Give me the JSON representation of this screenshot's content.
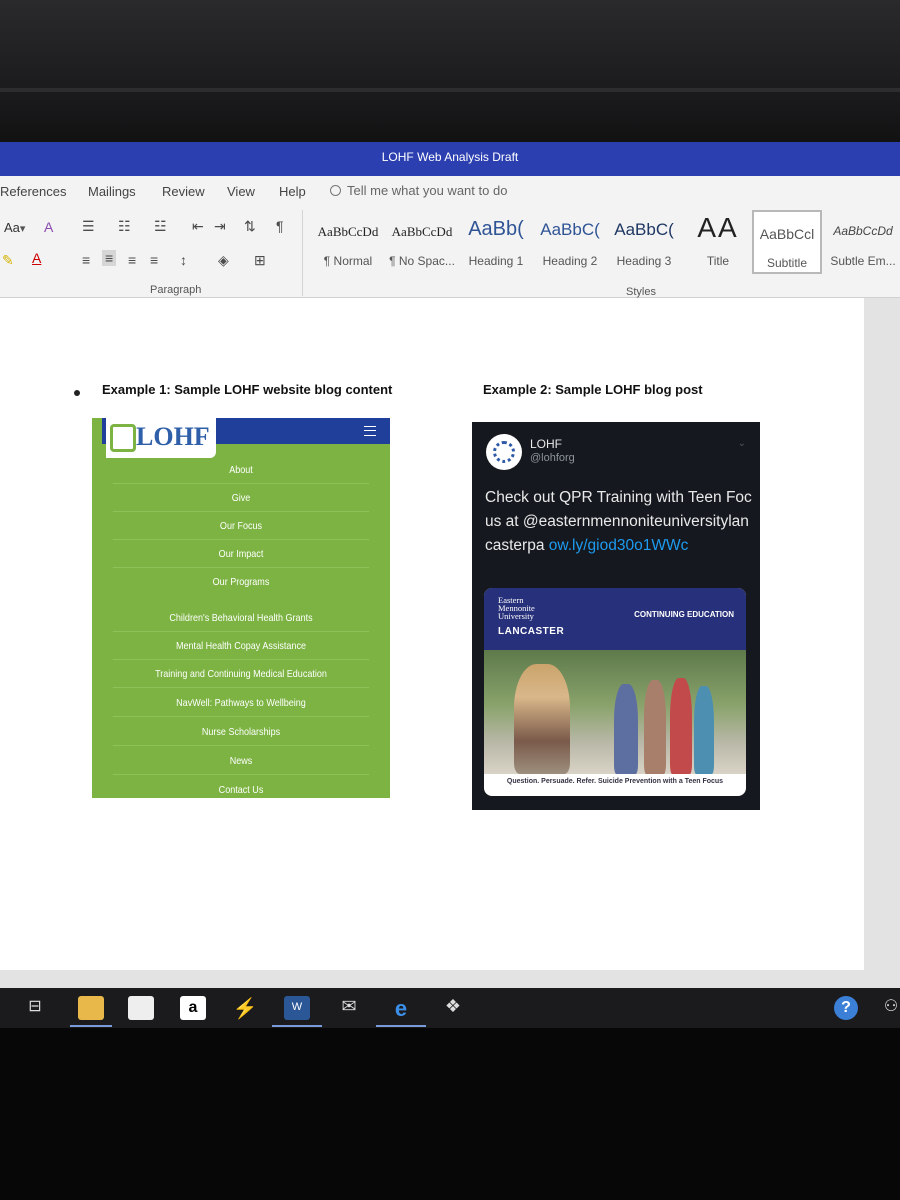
{
  "window": {
    "title": "LOHF Web Analysis Draft"
  },
  "tabs": [
    "References",
    "Mailings",
    "Review",
    "View",
    "Help"
  ],
  "tell_me": "Tell me what you want to do",
  "ribbon": {
    "font_size_label": "Aa",
    "paragraph_label": "Paragraph",
    "styles_label": "Styles",
    "styles": [
      {
        "sample": "AaBbCcDd",
        "name": "¶ Normal"
      },
      {
        "sample": "AaBbCcDd",
        "name": "¶ No Spac..."
      },
      {
        "sample": "AaBb(",
        "name": "Heading 1"
      },
      {
        "sample": "AaBbC(",
        "name": "Heading 2"
      },
      {
        "sample": "AaBbC(",
        "name": "Heading 3"
      },
      {
        "sample": "AA",
        "name": "Title"
      },
      {
        "sample": "AaBbCcl",
        "name": "Subtitle"
      },
      {
        "sample": "AaBbCcDd",
        "name": "Subtle Em..."
      }
    ]
  },
  "document": {
    "example1_heading": "Example 1: Sample LOHF website blog content",
    "example2_heading": "Example 2: Sample LOHF blog post",
    "example1": {
      "logo_text": "LOHF",
      "nav": [
        "About",
        "Give",
        "Our Focus",
        "Our Impact",
        "Our Programs",
        "Children's Behavioral Health Grants",
        "Mental Health Copay Assistance",
        "Training and Continuing Medical Education",
        "NavWell: Pathways to Wellbeing",
        "Nurse Scholarships",
        "News",
        "Contact Us"
      ]
    },
    "example2": {
      "name": "LOHF",
      "handle": "@lohforg",
      "tweet_text": "Check out QPR Training with Teen Focus at @easternmennoniteuniversitylancasterpa ",
      "tweet_link": "ow.ly/giod30o1WWc",
      "card": {
        "emu_lines": [
          "Eastern",
          "Mennonite",
          "University"
        ],
        "location": "LANCASTER",
        "program": "CONTINUING EDUCATION",
        "tagline": "Question. Persuade. Refer. Suicide Prevention with a Teen Focus"
      }
    }
  },
  "colors": {
    "title_bar": "#2b3fb0",
    "lohf_green": "#7cb342",
    "lohf_blue": "#1f3f9a",
    "tweet_bg": "#15181e",
    "link": "#1d9bf0"
  },
  "taskbar_icons": [
    "task-view-icon",
    "file-explorer-icon",
    "store-icon",
    "amazon-icon",
    "visual-studio-icon",
    "word-icon",
    "mail-icon",
    "edge-icon",
    "dropbox-icon",
    "help-icon",
    "people-icon"
  ]
}
